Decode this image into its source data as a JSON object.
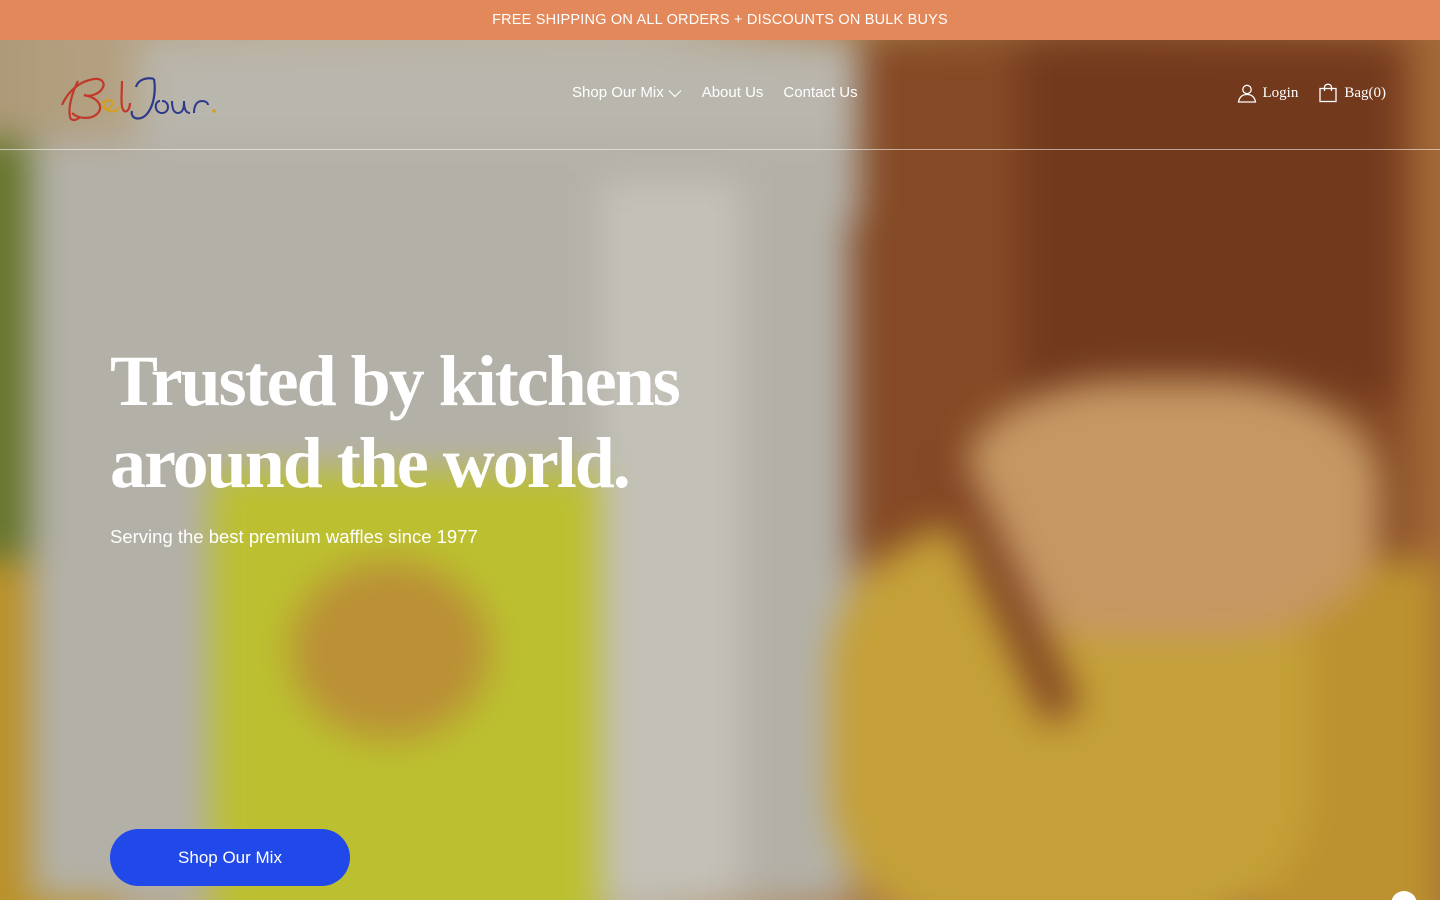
{
  "announcement": {
    "text": "FREE SHIPPING ON ALL ORDERS + DISCOUNTS ON BULK BUYS"
  },
  "header": {
    "logo_text": "BelJour",
    "nav": [
      {
        "label": "Shop Our Mix",
        "has_dropdown": true
      },
      {
        "label": "About Us"
      },
      {
        "label": "Contact Us"
      }
    ],
    "login_label": "Login",
    "bag_label": "Bag(0)"
  },
  "hero": {
    "title_line1": "Trusted by kitchens",
    "title_line2": "around the world.",
    "subtitle": "Serving the best premium waffles since 1977",
    "cta_label": "Shop Our Mix"
  },
  "colors": {
    "announcement_bg": "#e2885a",
    "cta_bg": "#2148e8",
    "text": "#ffffff",
    "logo_red": "#c0392b",
    "logo_blue": "#2c3a8c",
    "logo_gold": "#d4a017"
  },
  "icons": {
    "login": "user-icon",
    "bag": "shopping-bag-icon",
    "dropdown": "chevron-down-icon"
  }
}
